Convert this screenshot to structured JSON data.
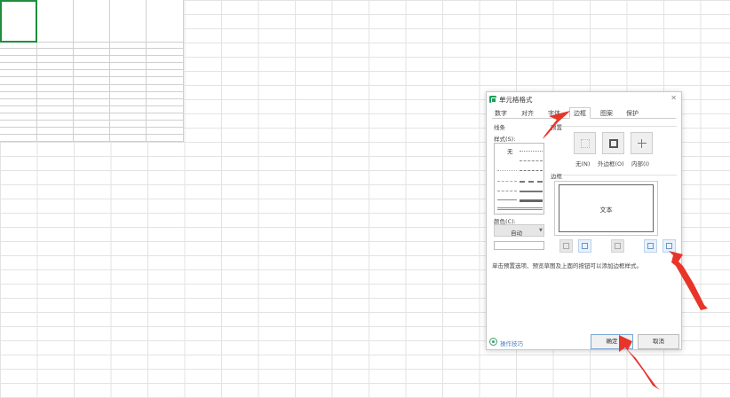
{
  "dialog": {
    "title": "单元格格式",
    "close_glyph": "✕",
    "tabs": [
      {
        "label": "数字"
      },
      {
        "label": "对齐"
      },
      {
        "label": "字体"
      },
      {
        "label": "边框",
        "active": true
      },
      {
        "label": "图案"
      },
      {
        "label": "保护"
      }
    ],
    "line_group_label": "线条",
    "style_label": "样式(S):",
    "style_none": "无",
    "color_label": "颜色(C):",
    "color_value": "自动",
    "preset_group_label": "预置",
    "presets": [
      {
        "label": "无(N)",
        "icon": "border-none-icon"
      },
      {
        "label": "外边框(O)",
        "icon": "border-outline-icon"
      },
      {
        "label": "内部(I)",
        "icon": "border-inside-icon"
      }
    ],
    "border_group_label": "边框",
    "preview_text": "文本",
    "hint": "单击预置选项、预览草图及上面的按钮可以添加边框样式。",
    "tips_link": "操作技巧",
    "ok_label": "确定",
    "cancel_label": "取消"
  },
  "colors": {
    "accent_green": "#1e8e3e",
    "annotation_red": "#e8352a",
    "link_blue": "#4a7fc0"
  }
}
